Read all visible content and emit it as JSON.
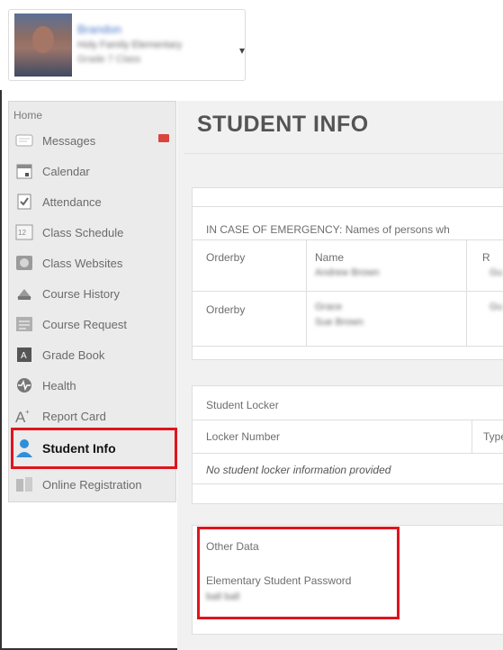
{
  "profile": {
    "name": "Brandon",
    "school": "Holy Family Elementary",
    "grade": "Grade 7 Class",
    "menu_caret": "▾"
  },
  "sidebar": {
    "home_label": "Home",
    "items": [
      {
        "label": "Messages",
        "icon": "messages-icon"
      },
      {
        "label": "Calendar",
        "icon": "calendar-icon"
      },
      {
        "label": "Attendance",
        "icon": "attendance-icon"
      },
      {
        "label": "Class Schedule",
        "icon": "schedule-icon"
      },
      {
        "label": "Class Websites",
        "icon": "websites-icon"
      },
      {
        "label": "Course History",
        "icon": "history-icon"
      },
      {
        "label": "Course Request",
        "icon": "request-icon"
      },
      {
        "label": "Grade Book",
        "icon": "gradebook-icon"
      },
      {
        "label": "Health",
        "icon": "health-icon"
      },
      {
        "label": "Report Card",
        "icon": "report-card-icon"
      },
      {
        "label": "Student Info",
        "icon": "student-info-icon"
      },
      {
        "label": "Online Registration",
        "icon": "registration-icon"
      }
    ]
  },
  "main": {
    "title": "STUDENT INFO",
    "emergency": {
      "header": "IN CASE OF EMERGENCY: Names of persons wh",
      "col_orderby": "Orderby",
      "col_name": "Name",
      "col_r": "R",
      "rows": [
        {
          "orderby": "Orderby",
          "name_line1": "Andrew Brown",
          "name_line2": ""
        },
        {
          "orderby": "Orderby",
          "name_line1": "Grace",
          "name_line2": "Sue Brown"
        }
      ]
    },
    "locker": {
      "header": "Student Locker",
      "col_locker_number": "Locker Number",
      "col_type": "Type",
      "empty_message": "No student locker information provided"
    },
    "other": {
      "header": "Other Data",
      "field_label": "Elementary Student Password",
      "field_value": "ball ball"
    }
  },
  "colors": {
    "highlight": "#e0141d",
    "sidebar_bg": "#ebebeb",
    "main_bg": "#f1f1f1"
  }
}
